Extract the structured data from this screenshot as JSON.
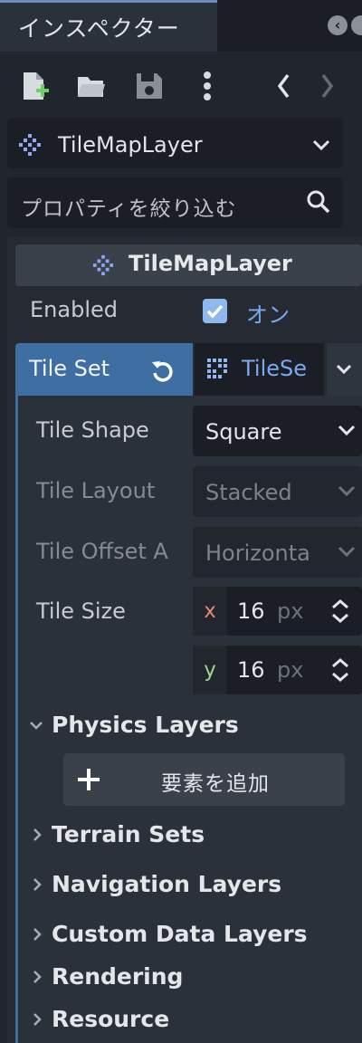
{
  "tab": {
    "title": "インスペクター"
  },
  "toolbar": {
    "items": [
      "new-resource",
      "open",
      "save",
      "more",
      "back",
      "forward"
    ]
  },
  "object_selector": {
    "name": "TileMapLayer"
  },
  "filter": {
    "placeholder": "プロパティを絞り込む"
  },
  "section": {
    "title": "TileMapLayer"
  },
  "enabled": {
    "label": "Enabled",
    "value": "オン",
    "checked": true
  },
  "tile_set": {
    "label": "Tile Set",
    "resource": "TileSe"
  },
  "tile_shape": {
    "label": "Tile Shape",
    "value": "Square"
  },
  "tile_layout": {
    "label": "Tile Layout",
    "value": "Stacked"
  },
  "tile_offset": {
    "label": "Tile Offset A",
    "value": "Horizonta"
  },
  "tile_size": {
    "label": "Tile Size",
    "x_axis": "x",
    "x": "16",
    "y_axis": "y",
    "y": "16",
    "unit": "px"
  },
  "groups": {
    "physics": "Physics Layers",
    "add_element": "要素を追加",
    "terrain": "Terrain Sets",
    "navigation": "Navigation Layers",
    "custom_data": "Custom Data Layers",
    "rendering": "Rendering",
    "resource": "Resource"
  },
  "colors": {
    "accent": "#3e6ea2",
    "link": "#7aa9f0",
    "axis_x": "#e0887a",
    "axis_y": "#9fd38e"
  }
}
